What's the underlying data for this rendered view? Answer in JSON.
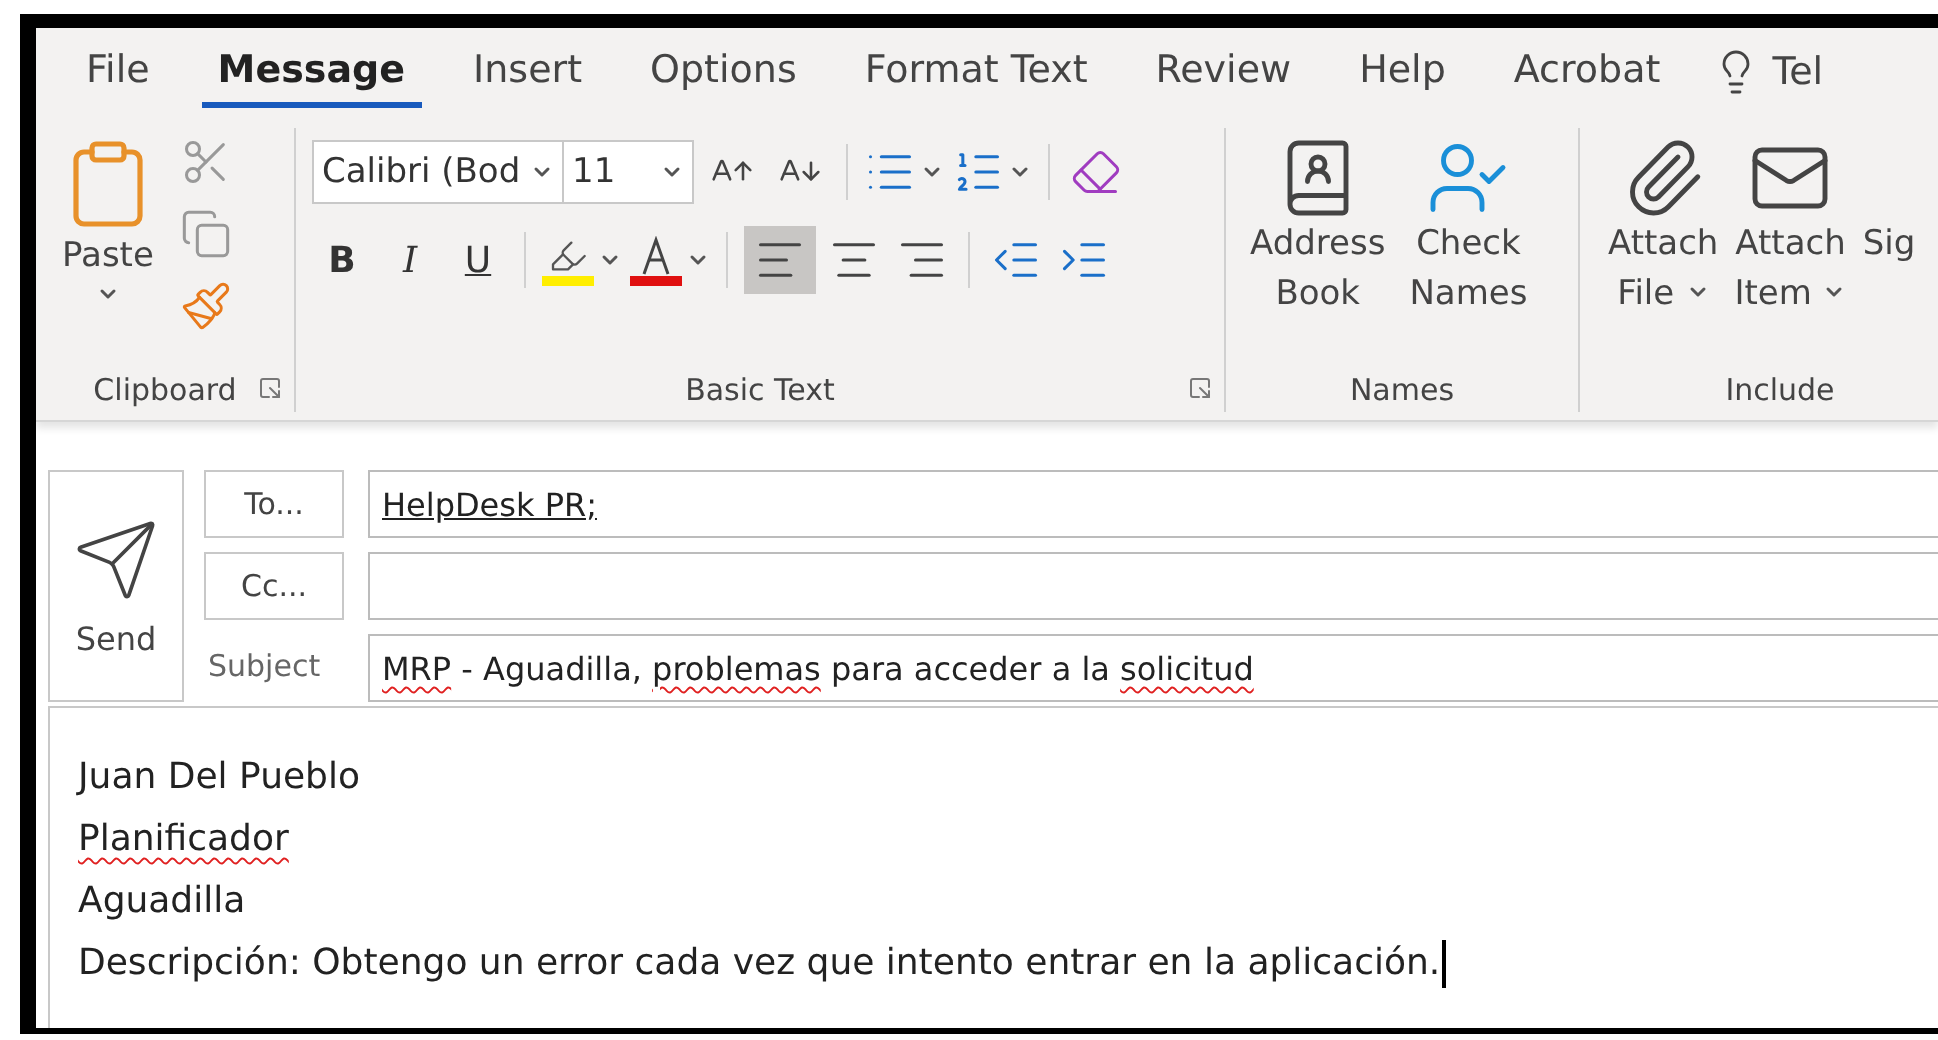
{
  "menu_tabs": [
    {
      "label": "File",
      "selected": false
    },
    {
      "label": "Message",
      "selected": true
    },
    {
      "label": "Insert",
      "selected": false
    },
    {
      "label": "Options",
      "selected": false
    },
    {
      "label": "Format Text",
      "selected": false
    },
    {
      "label": "Review",
      "selected": false
    },
    {
      "label": "Help",
      "selected": false
    },
    {
      "label": "Acrobat",
      "selected": false
    }
  ],
  "tell_me": "Tel",
  "clipboard": {
    "paste": "Paste",
    "label": "Clipboard"
  },
  "basic_text": {
    "font": "Calibri (Bod",
    "size": "11",
    "bold": "B",
    "italic": "I",
    "underline": "U",
    "align_left_selected": true,
    "label": "Basic Text"
  },
  "names": {
    "label": "Names",
    "buttons": [
      {
        "kind": "book",
        "line1": "Address",
        "line2": "Book"
      },
      {
        "kind": "check",
        "line1": "Check",
        "line2": "Names"
      }
    ]
  },
  "include": {
    "label": "Include",
    "buttons": [
      {
        "kind": "file",
        "line1": "Attach",
        "line2": "File",
        "dropdown": true
      },
      {
        "kind": "item",
        "line1": "Attach",
        "line2": "Item",
        "dropdown": true
      },
      {
        "kind": "cut",
        "line1": "Sig"
      }
    ]
  },
  "send": "Send",
  "to_button": "To...",
  "to_value": "HelpDesk PR;",
  "cc_button": "Cc...",
  "subject_label": "Subject",
  "subject": [
    {
      "text": "MRP",
      "misspelled": true
    },
    {
      "text": " - Aguadilla, ",
      "misspelled": false
    },
    {
      "text": "problemas",
      "misspelled": true
    },
    {
      "text": " para acceder a la ",
      "misspelled": false
    },
    {
      "text": "solicitud",
      "misspelled": true
    }
  ],
  "body": [
    [
      {
        "text": "Juan Del Pueblo",
        "misspelled": false
      }
    ],
    [
      {
        "text": "Planificador",
        "misspelled": true
      }
    ],
    [
      {
        "text": "Aguadilla",
        "misspelled": false
      }
    ],
    [
      {
        "text": "Descripción: Obtengo un error cada vez que intento entrar en la aplicación.",
        "misspelled": false
      }
    ]
  ]
}
